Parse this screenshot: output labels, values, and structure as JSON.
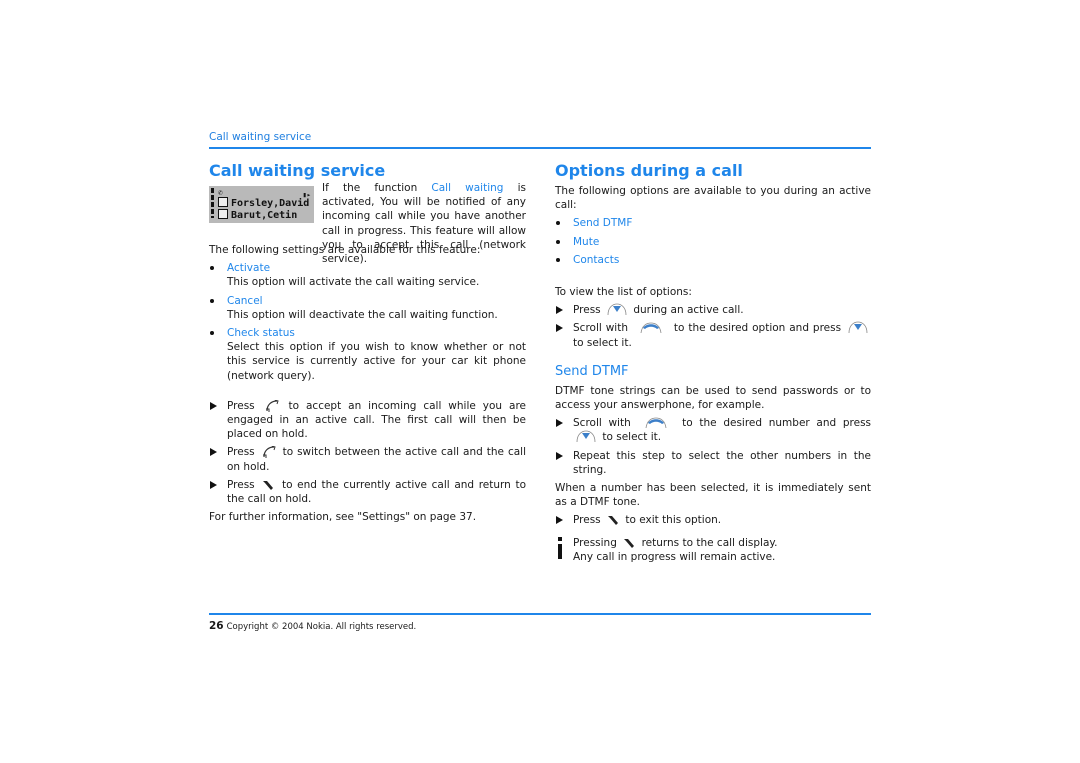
{
  "running_head": "Call waiting service",
  "left": {
    "title": "Call waiting service",
    "screen": {
      "entries": [
        "Forsley,David",
        "Barut,Cetin"
      ]
    },
    "intro": {
      "before": "If the function ",
      "link": "Call waiting",
      "after": " is activated, You will be notified of any incoming call while you have another call in progress. This feature will allow you to accept this call (network service)."
    },
    "settings_lead": "The following settings are available for this feature:",
    "settings": [
      {
        "label": "Activate",
        "desc": "This option will activate the call waiting service."
      },
      {
        "label": "Cancel",
        "desc": "This option will deactivate the call waiting function."
      },
      {
        "label": "Check status",
        "desc": "Select this option if you wish to know whether or not this service is currently active for your car kit phone (network query)."
      }
    ],
    "steps": [
      {
        "pre": "Press",
        "icon": "call-key-icon",
        "post": "to accept an incoming call while you are engaged in an active call. The first call will then be placed on hold."
      },
      {
        "pre": "Press",
        "icon": "call-key-icon",
        "post": "to switch between the active call and the call on hold."
      },
      {
        "pre": "Press",
        "icon": "end-key-icon",
        "post": "to end the currently active call and return to the call on hold."
      }
    ],
    "further": "For further information, see \"Settings\" on page 37."
  },
  "right": {
    "title": "Options during a call",
    "lead": "The following options are available to you during an active call:",
    "options": [
      "Send DTMF",
      "Mute",
      "Contacts"
    ],
    "view_lead": "To view the list of options:",
    "view_steps": [
      {
        "pre": "Press",
        "icon": "menu-key-icon",
        "post": "during an active call."
      },
      {
        "pre": "Scroll with",
        "icon": "scroll-key-icon",
        "mid": "to the desired option and press",
        "icon2": "menu-key-icon",
        "post": "to select it."
      }
    ],
    "dtmf": {
      "title": "Send DTMF",
      "desc": "DTMF tone strings can be used to send passwords or to access your answerphone, for example.",
      "steps": [
        {
          "pre": "Scroll with",
          "icon": "scroll-key-icon",
          "mid": "to the desired number and press",
          "icon2": "menu-key-icon",
          "post": "to select it."
        },
        {
          "text": "Repeat this step to select the other numbers in the string."
        }
      ],
      "after": "When a number has been selected, it is immediately sent as a DTMF tone.",
      "exit_step": {
        "pre": "Press",
        "icon": "end-key-icon",
        "post": "to exit this option."
      },
      "note": {
        "pre": "Pressing",
        "icon": "end-key-icon",
        "post": "returns to the call display.",
        "line2": "Any call in progress will remain active."
      }
    }
  },
  "footer": {
    "page_number": "26",
    "copyright": "Copyright © 2004 Nokia. All rights reserved."
  }
}
